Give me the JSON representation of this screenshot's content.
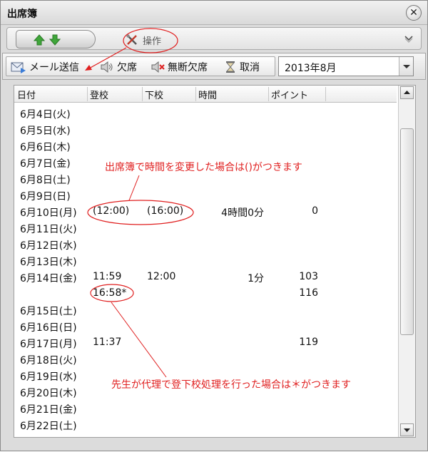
{
  "window": {
    "title": "出席簿"
  },
  "tabbar": {
    "ops_label": "操作"
  },
  "toolbar": {
    "buttons": [
      {
        "label": "メール送信",
        "icon": "mail-send-icon"
      },
      {
        "label": "欠席",
        "icon": "speaker-icon"
      },
      {
        "label": "無断欠席",
        "icon": "speaker-muted-icon"
      },
      {
        "label": "取消",
        "icon": "hourglass-icon"
      }
    ],
    "month": "2013年8月"
  },
  "grid": {
    "columns": [
      "日付",
      "登校",
      "下校",
      "時間",
      "ポイント"
    ],
    "rows": [
      {
        "date": "6月4日(火)",
        "in": "",
        "out": "",
        "time": "",
        "points": ""
      },
      {
        "date": "6月5日(水)",
        "in": "",
        "out": "",
        "time": "",
        "points": ""
      },
      {
        "date": "6月6日(木)",
        "in": "",
        "out": "",
        "time": "",
        "points": ""
      },
      {
        "date": "6月7日(金)",
        "in": "",
        "out": "",
        "time": "",
        "points": ""
      },
      {
        "date": "6月8日(土)",
        "in": "",
        "out": "",
        "time": "",
        "points": ""
      },
      {
        "date": "6月9日(日)",
        "in": "",
        "out": "",
        "time": "",
        "points": ""
      },
      {
        "date": "6月10日(月)",
        "in": "(12:00)",
        "out": "(16:00)",
        "time": "4時間0分",
        "points": "0"
      },
      {
        "date": "6月11日(火)",
        "in": "",
        "out": "",
        "time": "",
        "points": ""
      },
      {
        "date": "6月12日(水)",
        "in": "",
        "out": "",
        "time": "",
        "points": ""
      },
      {
        "date": "6月13日(木)",
        "in": "",
        "out": "",
        "time": "",
        "points": ""
      },
      {
        "date": "6月14日(金)",
        "in": "11:59",
        "out": "12:00",
        "time": "1分",
        "points": "103"
      },
      {
        "date": "",
        "in": "16:58*",
        "out": "",
        "time": "",
        "points": "116"
      },
      {
        "date": "6月15日(土)",
        "in": "",
        "out": "",
        "time": "",
        "points": ""
      },
      {
        "date": "6月16日(日)",
        "in": "",
        "out": "",
        "time": "",
        "points": ""
      },
      {
        "date": "6月17日(月)",
        "in": "11:37",
        "out": "",
        "time": "",
        "points": "119"
      },
      {
        "date": "6月18日(火)",
        "in": "",
        "out": "",
        "time": "",
        "points": ""
      },
      {
        "date": "6月19日(水)",
        "in": "",
        "out": "",
        "time": "",
        "points": ""
      },
      {
        "date": "6月20日(木)",
        "in": "",
        "out": "",
        "time": "",
        "points": ""
      },
      {
        "date": "6月21日(金)",
        "in": "",
        "out": "",
        "time": "",
        "points": ""
      },
      {
        "date": "6月22日(土)",
        "in": "",
        "out": "",
        "time": "",
        "points": ""
      }
    ]
  },
  "annotations": {
    "note_parentheses": "出席簿で時間を変更した場合は()がつきます",
    "note_asterisk": "先生が代理で登下校処理を行った場合は＊がつきます",
    "color": "#e01f1f"
  }
}
